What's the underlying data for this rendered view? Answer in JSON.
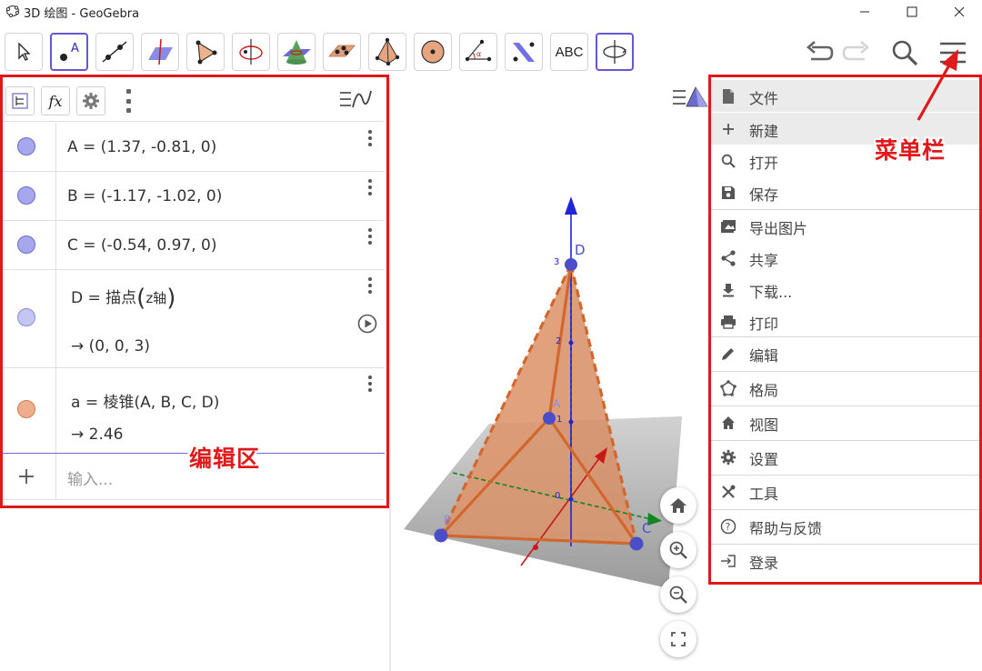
{
  "window": {
    "title": "3D 绘图 - GeoGebra"
  },
  "toolbar": {
    "tools": [
      "move-tool",
      "point-tool",
      "line-tool",
      "perpendicular-tool",
      "polygon-tool",
      "circle-axis-tool",
      "intersect-tool",
      "plane-tool",
      "pyramid-tool",
      "sphere-tool",
      "angle-tool",
      "reflect-tool",
      "text-tool",
      "rotate-view-tool"
    ],
    "text_tool_label": "ABC"
  },
  "algebra": {
    "rows": [
      {
        "color": "#a7a7ee",
        "text": "A = (1.37, -0.81, 0)"
      },
      {
        "color": "#a7a7ee",
        "text": "B = (-1.17, -1.02, 0)"
      },
      {
        "color": "#a7a7ee",
        "text": "C = (-0.54, 0.97, 0)"
      },
      {
        "color": "#c5c5f3",
        "pre": "D = 描点",
        "arg": "z轴",
        "result": "→  (0, 0, 3)"
      },
      {
        "color": "#efae8e",
        "text": "a = 棱锥(A, B, C, D)",
        "result": "→  2.46"
      }
    ],
    "input_placeholder": "输入..."
  },
  "annotations": {
    "algebra_label": "编辑区",
    "menu_label": "菜单栏"
  },
  "menu": {
    "items": [
      {
        "label": "文件",
        "icon": "file-icon"
      },
      {
        "label": "新建",
        "icon": "plus-icon"
      },
      {
        "label": "打开",
        "icon": "search-icon"
      },
      {
        "label": "保存",
        "icon": "save-icon"
      },
      {
        "label": "导出图片",
        "icon": "image-icon"
      },
      {
        "label": "共享",
        "icon": "share-icon"
      },
      {
        "label": "下载...",
        "icon": "download-icon"
      },
      {
        "label": "打印",
        "icon": "print-icon"
      },
      {
        "label": "编辑",
        "icon": "pencil-icon"
      },
      {
        "label": "格局",
        "icon": "perspectives-icon"
      },
      {
        "label": "视图",
        "icon": "home-icon"
      },
      {
        "label": "设置",
        "icon": "gear-icon"
      },
      {
        "label": "工具",
        "icon": "tools-icon"
      },
      {
        "label": "帮助与反馈",
        "icon": "help-icon"
      },
      {
        "label": "登录",
        "icon": "login-icon"
      }
    ]
  },
  "graphics": {
    "axis_labels": {
      "z3": "3",
      "z2": "2",
      "z1": "1",
      "z0": "0"
    },
    "point_labels": {
      "A": "A",
      "B": "B",
      "C": "C",
      "D": "D"
    },
    "colors": {
      "pyramid": "#d2672d",
      "pyramid_fill": "#e7a57f",
      "point": "#4a4fc9",
      "z_axis": "#1f25d6",
      "x_axis": "#c81818",
      "y_axis": "#11871f"
    }
  }
}
